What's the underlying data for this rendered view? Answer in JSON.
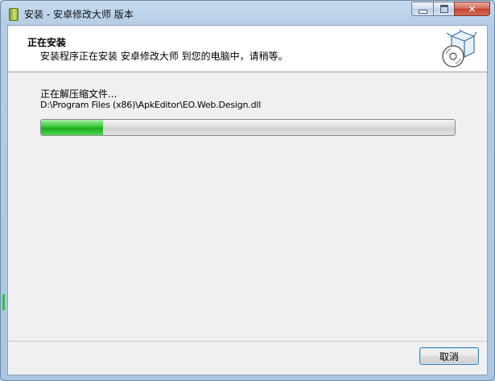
{
  "window": {
    "title": "安装 - 安卓修改大师 版本",
    "controls": {
      "minimize": "minimize",
      "maximize": "maximize",
      "close": "×"
    }
  },
  "header": {
    "title": "正在安装",
    "subtitle": "安装程序正在安装 安卓修改大师 到您的电脑中，请稍等。",
    "icon": "setup-box-cd-icon"
  },
  "main": {
    "status": "正在解压缩文件...",
    "path": "D:\\Program Files (x86)\\ApkEditor\\EO.Web.Design.dll",
    "progress": 0.15
  },
  "footer": {
    "cancel_label": "取消"
  },
  "colors": {
    "progress_fill": "#2bbf2b",
    "close_button": "#c5442c",
    "frame": "#b4cde6"
  }
}
